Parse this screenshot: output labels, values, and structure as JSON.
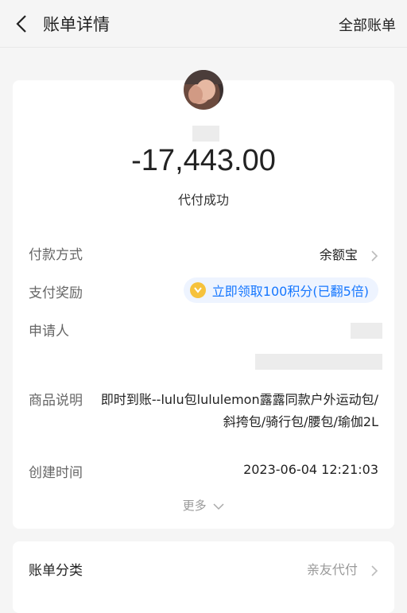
{
  "header": {
    "title": "账单详情",
    "right_action": "全部账单"
  },
  "summary": {
    "amount": "-17,443.00",
    "status": "代付成功"
  },
  "details": {
    "payment_method_label": "付款方式",
    "payment_method_value": "余额宝",
    "reward_label": "支付奖励",
    "reward_value": "立即领取100积分(已翻5倍)",
    "applicant_label": "申请人",
    "product_label": "商品说明",
    "product_value": "即时到账--lulu包lululemon露露同款户外运动包/斜挎包/骑行包/腰包/瑜伽2L",
    "created_label": "创建时间",
    "created_value": "2023-06-04 12:21:03",
    "more_label": "更多"
  },
  "category": {
    "label": "账单分类",
    "value": "亲友代付"
  },
  "icons": {
    "back": "back-arrow-icon",
    "chevron": "chevron-right-icon",
    "coin": "coin-icon",
    "more": "chevron-down-icon"
  },
  "colors": {
    "accent_blue": "#1677ff",
    "coin_gold": "#f6c23c"
  }
}
